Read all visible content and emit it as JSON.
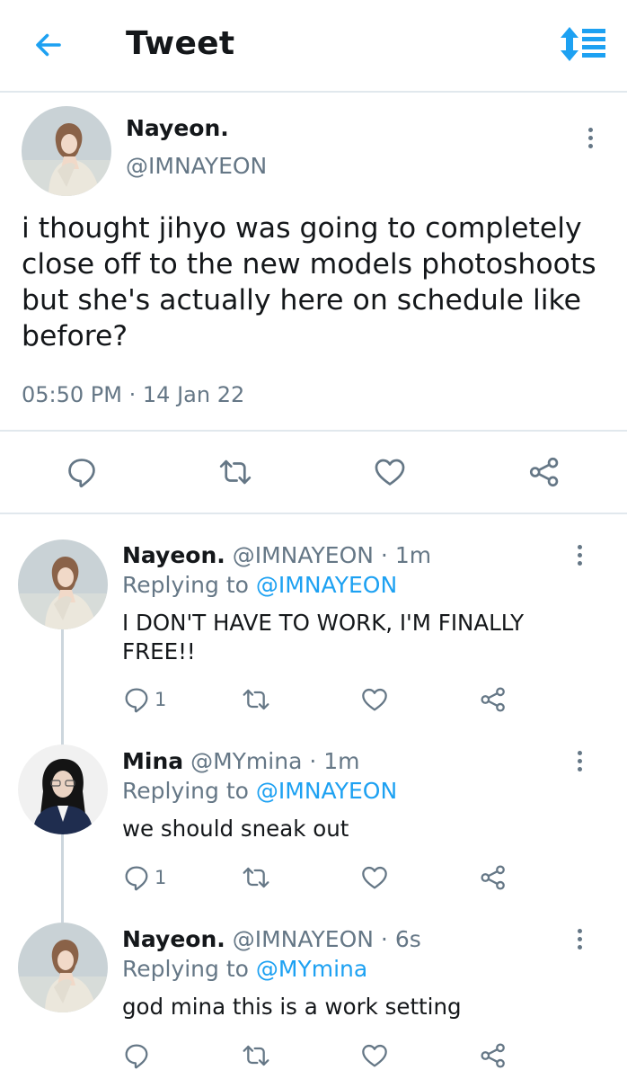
{
  "header": {
    "title": "Tweet",
    "back_icon": "arrow-left-icon",
    "sort_icon": "sort-lines-icon",
    "accent_color": "#1da1f2"
  },
  "main_tweet": {
    "name": "Nayeon.",
    "handle": "@IMNAYEON",
    "text": "i thought jihyo was going to completely close off to the new models photoshoots but she's actually here on schedule like before?",
    "time": "05:50 PM",
    "separator": "·",
    "date": "14 Jan 22"
  },
  "replies": [
    {
      "name": "Nayeon.",
      "handle": "@IMNAYEON",
      "time": "· 1m",
      "replying_label": "Replying to",
      "replying_to": "@IMNAYEON",
      "text": "I DON'T HAVE TO WORK, I'M FINALLY FREE!!",
      "reply_count": "1"
    },
    {
      "name": "Mina",
      "handle": "@MYmina",
      "time": "· 1m",
      "replying_label": "Replying to",
      "replying_to": "@IMNAYEON",
      "text": "we should sneak out",
      "reply_count": "1"
    },
    {
      "name": "Nayeon.",
      "handle": "@IMNAYEON",
      "time": "· 6s",
      "replying_label": "Replying to",
      "replying_to": "@MYmina",
      "text": "god mina this is a work setting",
      "reply_count": ""
    }
  ]
}
